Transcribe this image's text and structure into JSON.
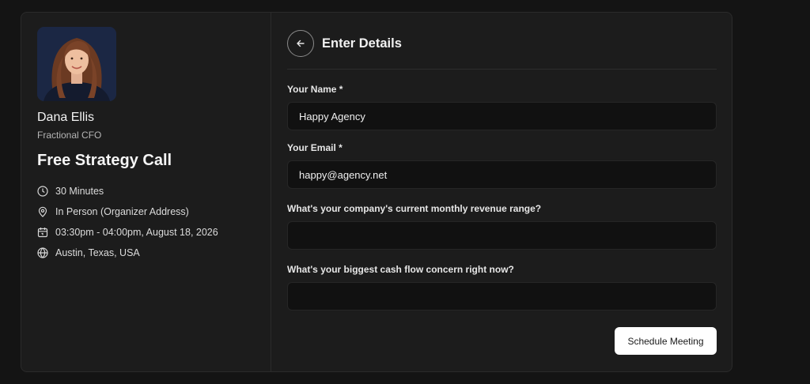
{
  "host": {
    "name": "Dana Ellis",
    "title": "Fractional CFO"
  },
  "event": {
    "title": "Free Strategy Call",
    "duration": "30 Minutes",
    "location": "In Person (Organizer Address)",
    "datetime": "03:30pm - 04:00pm, August 18, 2026",
    "timezone_location": "Austin, Texas, USA",
    "icons": [
      "clock-icon",
      "location-pin-icon",
      "calendar-icon",
      "globe-icon"
    ]
  },
  "form": {
    "header_title": "Enter Details",
    "fields": [
      {
        "label": "Your Name *",
        "value": "Happy Agency"
      },
      {
        "label": "Your Email *",
        "value": "happy@agency.net"
      },
      {
        "label": "What's your company's current monthly revenue range?",
        "value": ""
      },
      {
        "label": "What's your biggest cash flow concern right now?",
        "value": ""
      }
    ],
    "submit_label": "Schedule Meeting"
  },
  "colors": {
    "background": "#141414",
    "card": "#1c1c1c",
    "input": "#111111",
    "button": "#ffffff"
  }
}
